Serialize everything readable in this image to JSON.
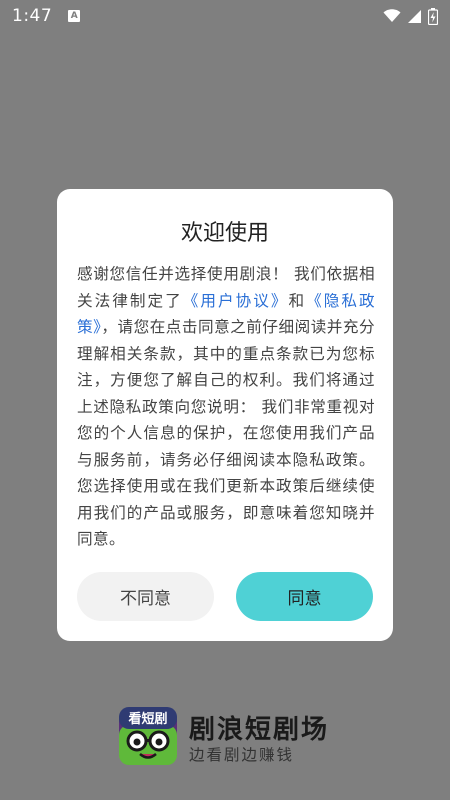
{
  "status_bar": {
    "time": "1:47",
    "notification_badge": "A",
    "icons": [
      "wifi-icon",
      "signal-icon",
      "battery-icon"
    ]
  },
  "dialog": {
    "title": "欢迎使用",
    "body": {
      "part1": "感谢您信任并选择使用剧浪！ 我们依据相关法律制定了",
      "link_user_agreement": "《用户协议》",
      "part2": "和",
      "link_privacy_policy": "《隐私政策》",
      "part3": "，请您在点击同意之前仔细阅读并充分理解相关条款，其中的重点条款已为您标注，方便您了解自己的权利。我们将通过上述隐私政策向您说明： 我们非常重视对您的个人信息的保护，在您使用我们产品与服务前，请务必仔细阅读本隐私政策。您选择使用或在我们更新本政策后继续使用我们的产品或服务，即意味着您知晓并同意。"
    },
    "buttons": {
      "disagree": "不同意",
      "agree": "同意"
    }
  },
  "brand": {
    "logo_text": "看短剧",
    "name": "剧浪短剧场",
    "slogan": "边看剧边赚钱"
  },
  "colors": {
    "overlay": "#7f7f7f",
    "link": "#2a6fd6",
    "agree_button": "#4fd1d5",
    "disagree_button": "#f2f2f2"
  }
}
